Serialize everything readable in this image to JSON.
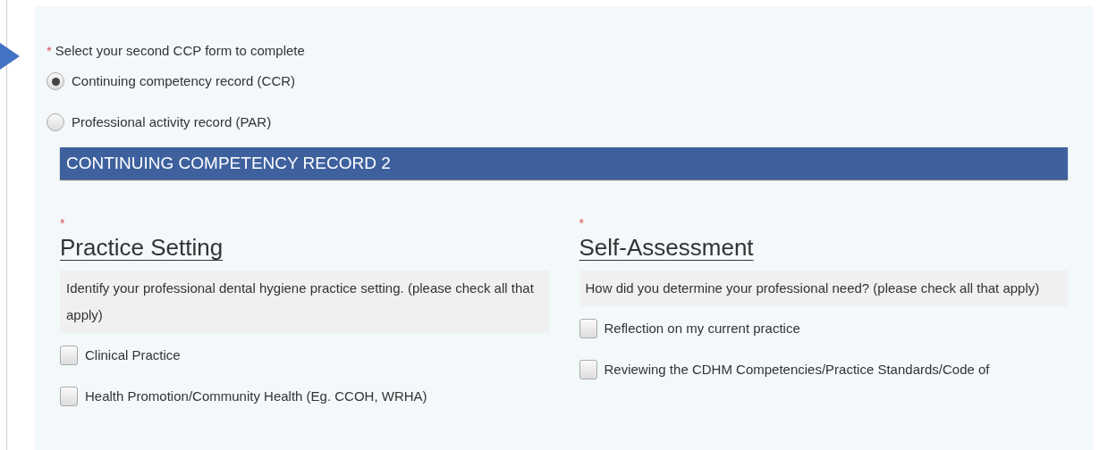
{
  "question": {
    "required_mark": "*",
    "label": "Select your second CCP form to complete"
  },
  "options": [
    {
      "label": "Continuing competency record (CCR)",
      "selected": true
    },
    {
      "label": "Professional activity record (PAR)",
      "selected": false
    }
  ],
  "section_title": "CONTINUING COMPETENCY RECORD 2",
  "columns": [
    {
      "required_mark": "*",
      "heading": "Practice Setting",
      "description": "Identify your professional dental hygiene practice setting. (please check all that apply)",
      "items": [
        {
          "label": "Clinical Practice",
          "checked": false
        },
        {
          "label": "Health Promotion/Community Health (Eg. CCOH, WRHA)",
          "checked": false
        }
      ]
    },
    {
      "required_mark": "*",
      "heading": "Self-Assessment",
      "description": "How did you determine your professional need? (please check all that apply)",
      "items": [
        {
          "label": "Reflection on my current practice",
          "checked": false
        },
        {
          "label": "Reviewing the CDHM Competencies/Practice Standards/Code of",
          "checked": false
        }
      ]
    }
  ]
}
